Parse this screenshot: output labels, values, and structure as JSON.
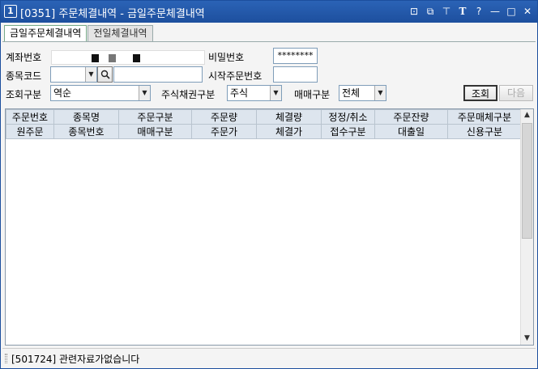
{
  "window": {
    "number": "1",
    "title": "[0351] 주문체결내역 - 금일주문체결내역"
  },
  "titlebar_icons": [
    "restore-icon",
    "copy-window-icon",
    "pin-icon",
    "font-icon",
    "help-icon",
    "minimize-icon",
    "maximize-icon",
    "close-icon"
  ],
  "titlebar_glyphs": {
    "restore": "⊡",
    "copy": "⧉",
    "pin": "⊤",
    "font": "T",
    "help": "?",
    "minimize": "—",
    "maximize": "□",
    "close": "✕"
  },
  "tabs": [
    {
      "label": "금일주문체결내역",
      "active": true
    },
    {
      "label": "전일체결내역",
      "active": false
    }
  ],
  "form": {
    "account_label": "계좌번호",
    "password_label": "비밀번호",
    "password_value": "********",
    "stock_code_label": "종목코드",
    "stock_code_value": "",
    "stock_name_value": "",
    "start_order_label": "시작주문번호",
    "start_order_value": "",
    "query_type_label": "조회구분",
    "query_type_value": "역순",
    "stock_bond_label": "주식채권구분",
    "stock_bond_value": "주식",
    "trade_type_label": "매매구분",
    "trade_type_value": "전체"
  },
  "buttons": {
    "query": "조회",
    "next": "다음"
  },
  "grid": {
    "header_row1": [
      "주문번호",
      "종목명",
      "주문구분",
      "주문량",
      "체결량",
      "정정/취소",
      "주문잔량",
      "주문매체구분"
    ],
    "header_row2": [
      "원주문",
      "종목번호",
      "매매구분",
      "주문가",
      "체결가",
      "접수구분",
      "대출일",
      "신용구분"
    ],
    "rows": []
  },
  "status": {
    "message": "[501724] 관련자료가없습니다"
  },
  "colors": {
    "titlebar": "#2b63b6",
    "grid_header": "#dde5ee"
  }
}
